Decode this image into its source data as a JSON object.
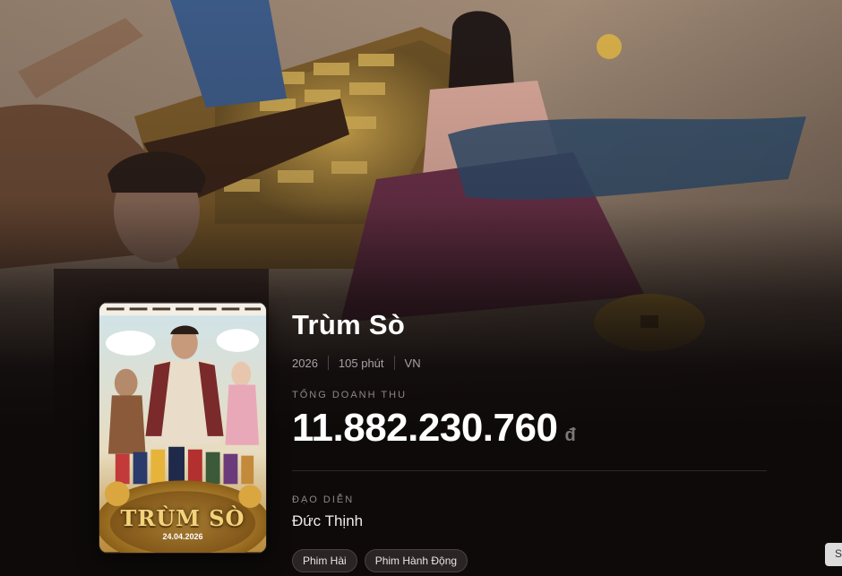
{
  "movie": {
    "title": "Trùm Sò",
    "year": "2026",
    "duration": "105 phút",
    "country": "VN",
    "poster": {
      "title_text": "TRÙM SÒ",
      "release_date": "24.04.2026"
    }
  },
  "revenue": {
    "label": "TỔNG DOANH THU",
    "amount": "11.882.230.760",
    "currency": "đ"
  },
  "director": {
    "label": "ĐẠO DIỄN",
    "name": "Đức Thịnh"
  },
  "genres": [
    "Phim Hài",
    "Phim Hành Động"
  ],
  "side_button": {
    "label": "S"
  },
  "colors": {
    "page_bg": "#0e0a0a",
    "chip_bg": "#2a2424",
    "gold": "#f3d27a"
  }
}
